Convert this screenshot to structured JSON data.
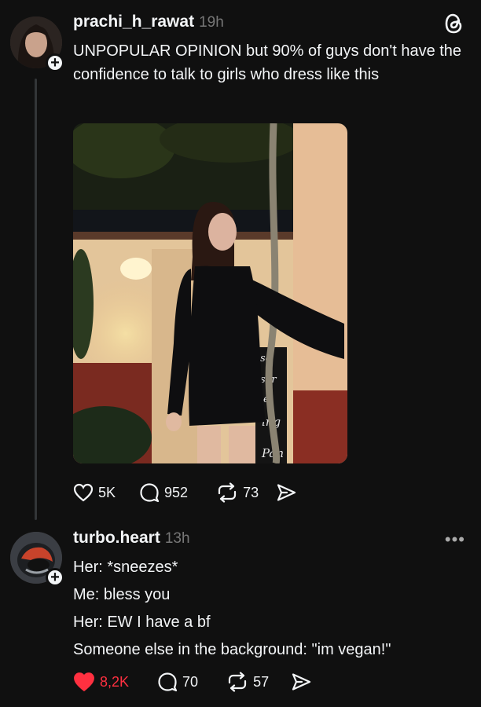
{
  "post": {
    "username": "prachi_h_rawat",
    "time": "19h",
    "text": "UNPOPULAR OPINION but 90% of guys don't have the confidence to talk to girls who dress like this",
    "likes": "5K",
    "comments": "952",
    "reposts": "73",
    "image_sign_lines": [
      "se",
      "ser",
      "e",
      "ing",
      "Pan"
    ]
  },
  "reply": {
    "username": "turbo.heart",
    "time": "13h",
    "lines": [
      "Her: *sneezes*",
      "Me: bless you",
      "Her: EW I have a bf",
      "Someone else in the background: \"im vegan!\""
    ],
    "likes": "8,2K",
    "comments": "70",
    "reposts": "57"
  },
  "icons": {
    "app": "threads-logo-icon",
    "like": "heart-icon",
    "comment": "comment-bubble-icon",
    "repost": "repost-icon",
    "share": "send-icon",
    "more": "more-dots-icon"
  },
  "colors": {
    "liked": "#ff3040",
    "background": "#101010"
  }
}
